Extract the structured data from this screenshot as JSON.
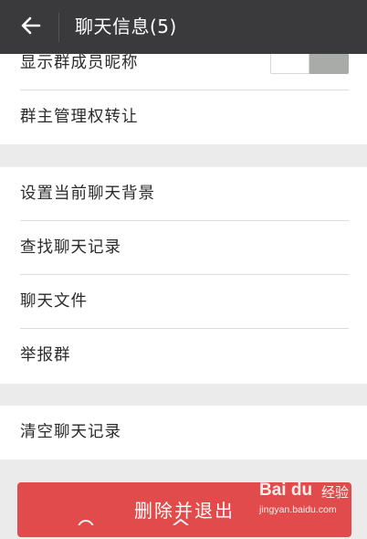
{
  "header": {
    "title": "聊天信息(5)",
    "back_icon": "arrow-left-icon"
  },
  "section1": {
    "items": [
      {
        "label": "显示群成员昵称",
        "toggle_on": false
      },
      {
        "label": "群主管理权转让"
      }
    ]
  },
  "section2": {
    "items": [
      {
        "label": "设置当前聊天背景"
      },
      {
        "label": "查找聊天记录"
      },
      {
        "label": "聊天文件"
      },
      {
        "label": "举报群"
      }
    ]
  },
  "section3": {
    "items": [
      {
        "label": "清空聊天记录"
      }
    ]
  },
  "delete_button": {
    "label": "删除并退出",
    "color": "#e14b4b"
  },
  "watermark": {
    "logo": "Bai du",
    "brand": "经验",
    "url": "jingyan.baidu.com"
  },
  "colors": {
    "header_bg": "#3a3a3c",
    "page_bg": "#ebebeb",
    "row_bg": "#ffffff",
    "toggle_off": "#a9aba8"
  }
}
